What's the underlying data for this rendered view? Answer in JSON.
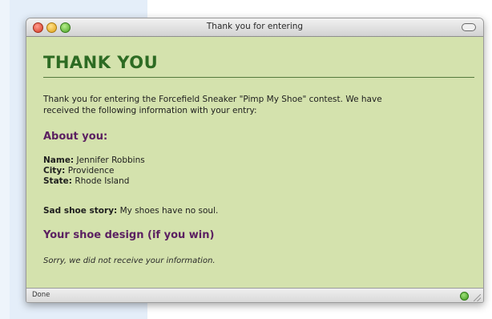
{
  "window": {
    "title": "Thank you for entering"
  },
  "page": {
    "heading": "THANK YOU",
    "intro_line1": "Thank you for entering the Forcefield Sneaker \"Pimp My Shoe\" contest. We have",
    "intro_line2": "received the following information with your entry:",
    "about_heading": "About you:",
    "name_label": "Name:",
    "name_value": "Jennifer Robbins",
    "city_label": "City:",
    "city_value": "Providence",
    "state_label": "State:",
    "state_value": "Rhode Island",
    "story_label": "Sad shoe story:",
    "story_value": "My shoes have no soul.",
    "design_heading": "Your shoe design (if you win)",
    "design_message": "Sorry, we did not receive your information."
  },
  "status": {
    "text": "Done"
  },
  "colors": {
    "page_background": "#d4e2ad",
    "heading": "#2d6b23",
    "subheading": "#5b2061"
  },
  "icons": [
    "close-button",
    "minimize-button",
    "zoom-button",
    "toolbar-toggle",
    "security-status-icon",
    "resize-grip"
  ]
}
